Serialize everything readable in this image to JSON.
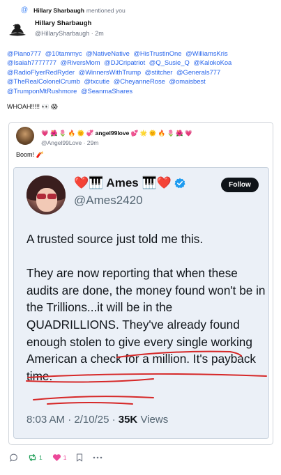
{
  "notification": {
    "icon": "at-icon",
    "name": "Hillary Sharbaugh",
    "suffix": "mentioned you"
  },
  "post": {
    "author_name": "Hillary Sharbaugh",
    "author_handle": "@HillarySharbaugh",
    "time": "· 2m",
    "mentions": [
      "@Piano777",
      "@10tammyc",
      "@NativeNative",
      "@HisTrustinOne",
      "@WilliamsKris",
      "@Isaiah7777777",
      "@RiversMom",
      "@DJCripatriot",
      "@Q_Susie_Q",
      "@KalokoKoa",
      "@RadioFlyerRedRyder",
      "@WinnersWithTrump",
      "@stitcher",
      "@Generals777",
      "@TheRealColonelCrumb",
      "@txcutie",
      "@CheyanneRose",
      "@omaisbest",
      "@TrumponMtRushmore",
      "@SeanmaShares"
    ],
    "text": "WHOAH!!!!! 👀 😱"
  },
  "quote": {
    "author_name": "💗 🌺 🌷 🔥 🌞 💞  angel99love 💕 🌟 🌞 🔥 🌷 🌺 💗",
    "author_handle": "@Angel99Love · 29m",
    "text": "Boom! 🧨",
    "embedded_tweet": {
      "name": "❤️🎹 Ames 🎹❤️",
      "handle": "@Ames2420",
      "follow_label": "Follow",
      "paragraphs": [
        "A trusted source just told me this.",
        "They are now reporting that when these audits are done, the money found won't be in the Trillions...it will be in the QUADRILLIONS. They've already found enough stolen to give every single working American a check for a million. It's payback time."
      ],
      "time": "8:03 AM · 2/10/25 · ",
      "views_count": "35K",
      "views_label": " Views"
    }
  },
  "actions": {
    "reply_icon": "reply-icon",
    "repost_count": "1",
    "like_count": "1",
    "bookmark_icon": "bookmark-icon",
    "more_icon": "more-icon"
  },
  "colors": {
    "link": "#2563eb",
    "repost": "#22a05a",
    "like": "#ec4899",
    "scribble": "#d62828",
    "tweet_bg": "#ebf0f7"
  }
}
